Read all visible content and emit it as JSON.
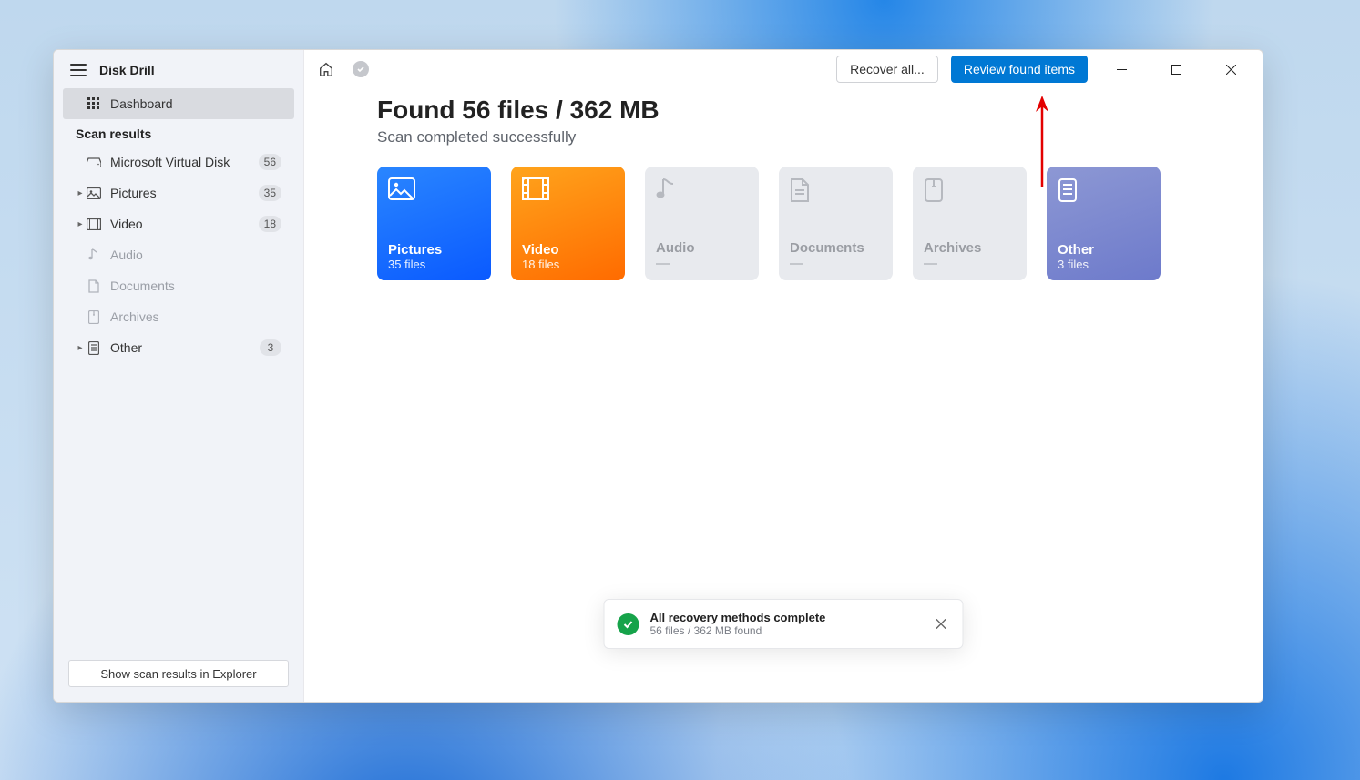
{
  "app": {
    "name": "Disk Drill"
  },
  "sidebar": {
    "dashboard": "Dashboard",
    "section_label": "Scan results",
    "items": [
      {
        "label": "Microsoft Virtual Disk",
        "count": "56"
      },
      {
        "label": "Pictures",
        "count": "35"
      },
      {
        "label": "Video",
        "count": "18"
      },
      {
        "label": "Audio",
        "count": ""
      },
      {
        "label": "Documents",
        "count": ""
      },
      {
        "label": "Archives",
        "count": ""
      },
      {
        "label": "Other",
        "count": "3"
      }
    ],
    "bottom_button": "Show scan results in Explorer"
  },
  "topbar": {
    "recover_all": "Recover all...",
    "review": "Review found items"
  },
  "content": {
    "headline": "Found 56 files / 362 MB",
    "subhead": "Scan completed successfully"
  },
  "cards": {
    "pictures": {
      "title": "Pictures",
      "sub": "35 files"
    },
    "video": {
      "title": "Video",
      "sub": "18 files"
    },
    "audio": {
      "title": "Audio",
      "sub": "—"
    },
    "documents": {
      "title": "Documents",
      "sub": "—"
    },
    "archives": {
      "title": "Archives",
      "sub": "—"
    },
    "other": {
      "title": "Other",
      "sub": "3 files"
    }
  },
  "toast": {
    "title": "All recovery methods complete",
    "sub": "56 files / 362 MB found"
  }
}
